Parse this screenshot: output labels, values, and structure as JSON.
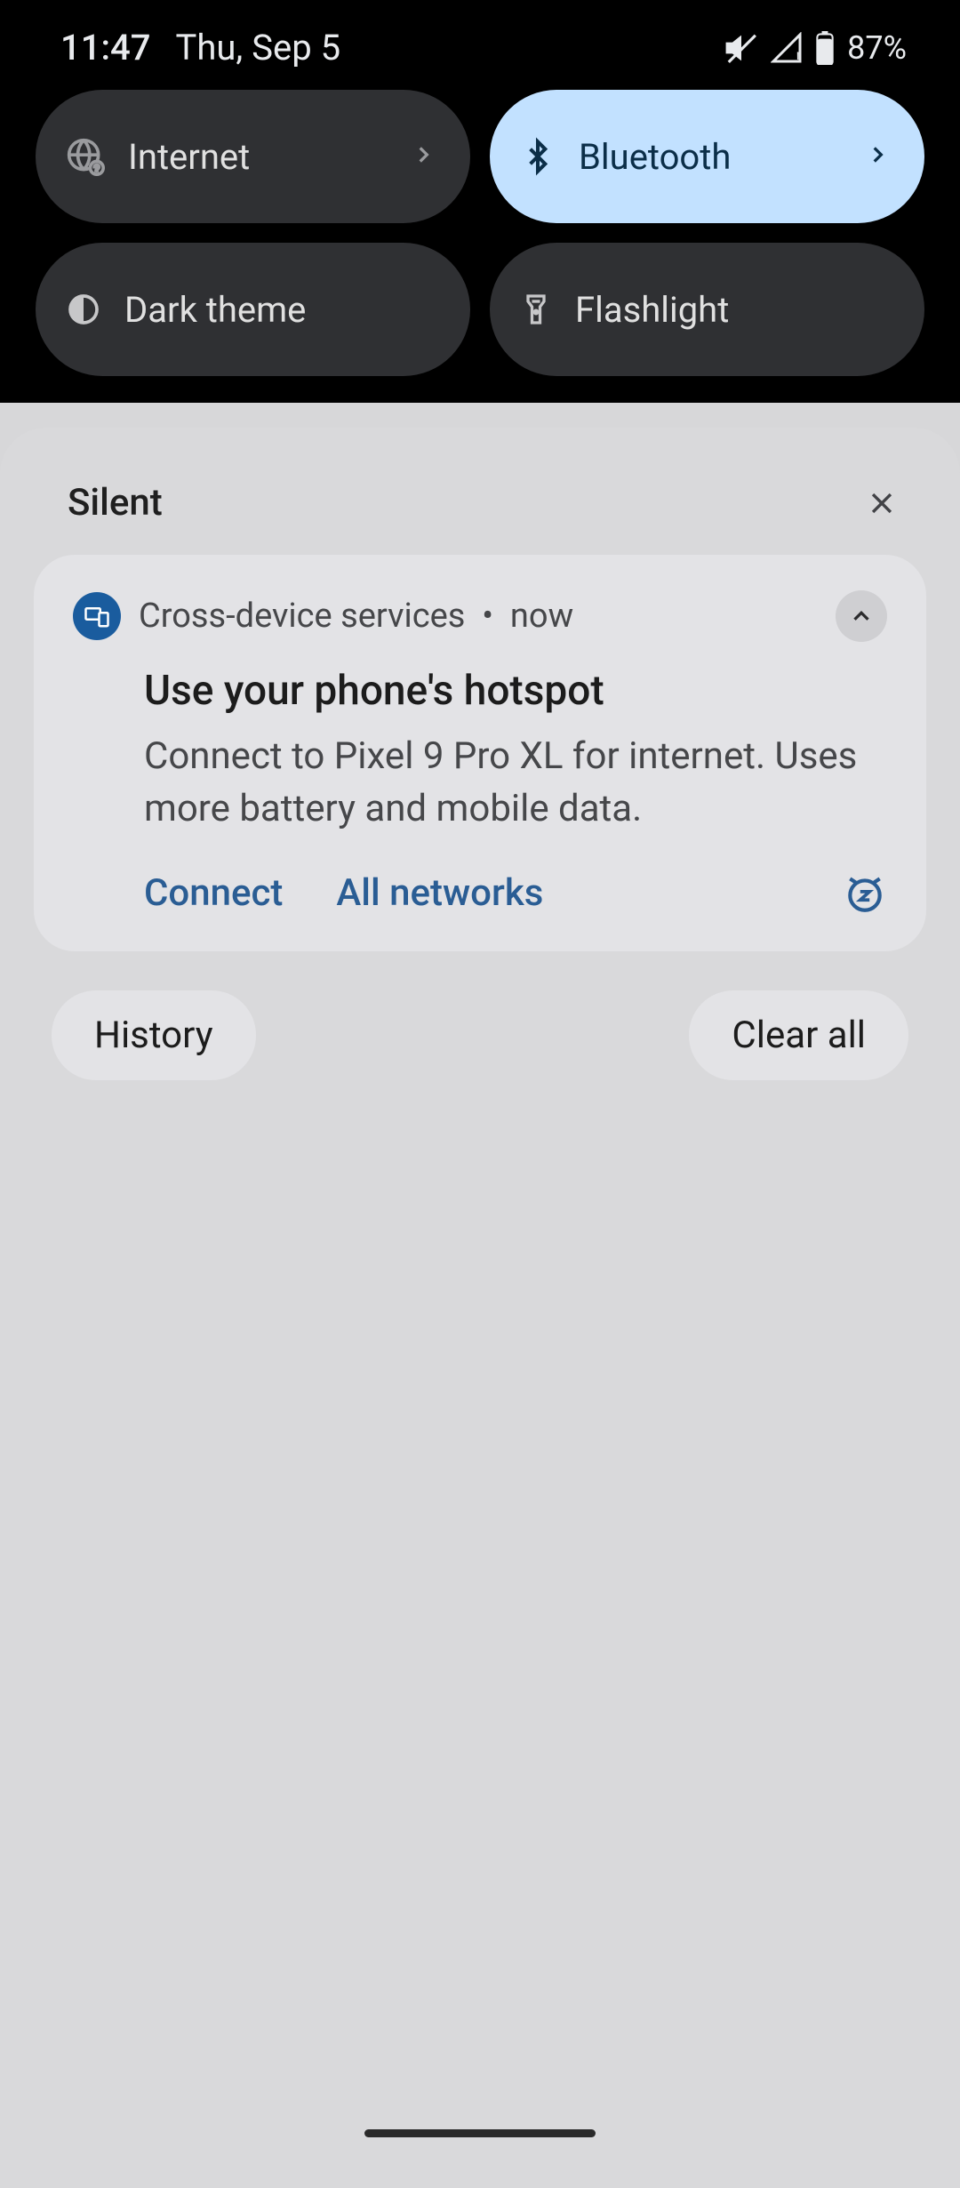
{
  "status": {
    "time": "11:47",
    "date": "Thu, Sep 5",
    "battery": "87%"
  },
  "quick_settings": {
    "internet": "Internet",
    "bluetooth": "Bluetooth",
    "dark_theme": "Dark theme",
    "flashlight": "Flashlight"
  },
  "notifications": {
    "section": "Silent",
    "card": {
      "app": "Cross-device services",
      "time": "now",
      "title": "Use your phone's hotspot",
      "body": "Connect to Pixel 9 Pro XL for internet. Uses more battery and mobile data.",
      "action_connect": "Connect",
      "action_all": "All networks"
    },
    "history": "History",
    "clear_all": "Clear all"
  }
}
